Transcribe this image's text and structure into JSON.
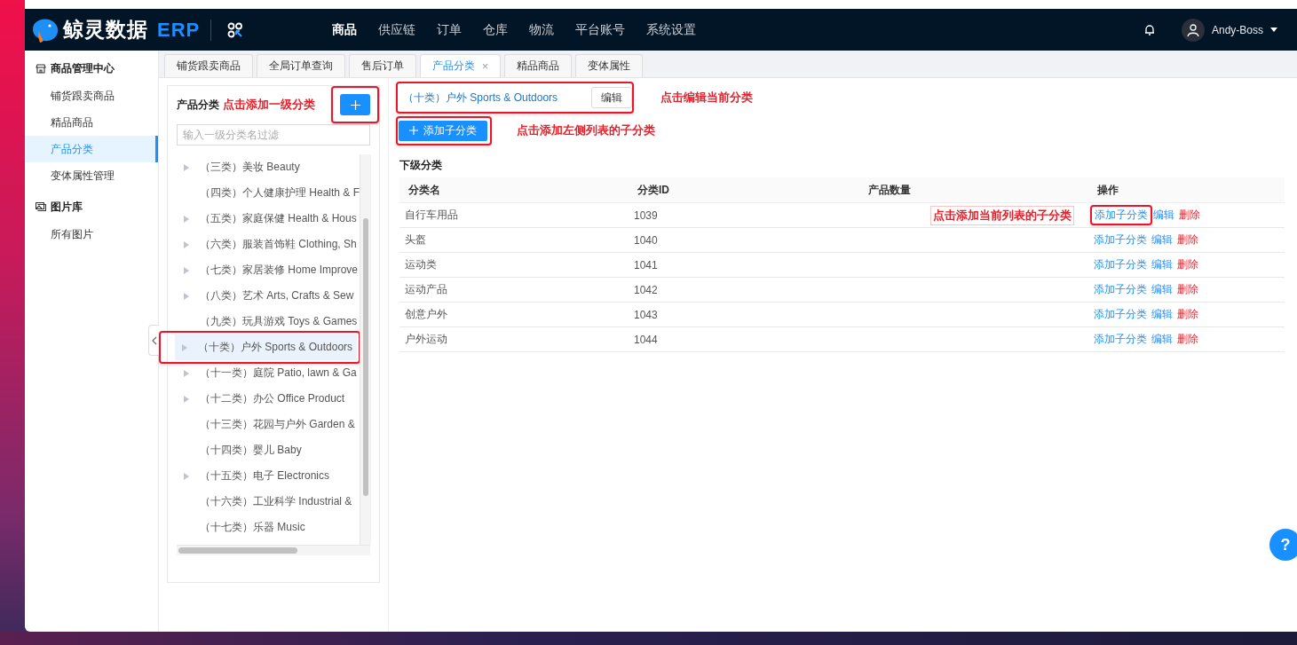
{
  "header": {
    "logo_text": "鲸灵数据",
    "logo_suffix": "ERP",
    "nav": [
      {
        "label": "商品",
        "selected": true
      },
      {
        "label": "供应链",
        "selected": false
      },
      {
        "label": "订单",
        "selected": false
      },
      {
        "label": "仓库",
        "selected": false
      },
      {
        "label": "物流",
        "selected": false
      },
      {
        "label": "平台账号",
        "selected": false
      },
      {
        "label": "系统设置",
        "selected": false
      }
    ],
    "user": "Andy-Boss"
  },
  "sidebar": {
    "groups": [
      {
        "title": "商品管理中心",
        "items": [
          {
            "label": "铺货跟卖商品",
            "selected": false
          },
          {
            "label": "精品商品",
            "selected": false
          },
          {
            "label": "产品分类",
            "selected": true
          },
          {
            "label": "变体属性管理",
            "selected": false
          }
        ]
      },
      {
        "title": "图片库",
        "items": [
          {
            "label": "所有图片",
            "selected": false
          }
        ]
      }
    ]
  },
  "tabs": [
    {
      "label": "铺货跟卖商品",
      "selected": false
    },
    {
      "label": "全局订单查询",
      "selected": false
    },
    {
      "label": "售后订单",
      "selected": false
    },
    {
      "label": "产品分类",
      "selected": true,
      "close": "×"
    },
    {
      "label": "精品商品",
      "selected": false
    },
    {
      "label": "变体属性",
      "selected": false
    }
  ],
  "category_panel": {
    "title": "产品分类",
    "annotation": "点击添加一级分类",
    "add_button": {
      "highlighted": true
    },
    "filter": {
      "placeholder": "输入一级分类名过滤"
    },
    "tree": [
      {
        "label": "（三类）美妆 Beauty",
        "expandable": true,
        "selected": false,
        "highlighted": false
      },
      {
        "label": "（四类）个人健康护理 Health & F",
        "expandable": false,
        "selected": false,
        "highlighted": false
      },
      {
        "label": "（五类）家庭保健 Health & Hous",
        "expandable": true,
        "selected": false,
        "highlighted": false
      },
      {
        "label": "（六类）服装首饰鞋 Clothing, Sh",
        "expandable": true,
        "selected": false,
        "highlighted": false
      },
      {
        "label": "（七类）家居装修 Home Improve",
        "expandable": true,
        "selected": false,
        "highlighted": false
      },
      {
        "label": "（八类）艺术 Arts, Crafts & Sew",
        "expandable": true,
        "selected": false,
        "highlighted": false
      },
      {
        "label": "（九类）玩具游戏 Toys & Games",
        "expandable": false,
        "selected": false,
        "highlighted": false
      },
      {
        "label": "（十类）户外 Sports & Outdoors",
        "expandable": true,
        "selected": true,
        "highlighted": true
      },
      {
        "label": "（十一类）庭院 Patio, lawn & Ga",
        "expandable": true,
        "selected": false,
        "highlighted": false
      },
      {
        "label": "（十二类）办公 Office Product",
        "expandable": true,
        "selected": false,
        "highlighted": false
      },
      {
        "label": "（十三类）花园与户外 Garden &",
        "expandable": false,
        "selected": false,
        "highlighted": false
      },
      {
        "label": "（十四类）婴儿 Baby",
        "expandable": false,
        "selected": false,
        "highlighted": false
      },
      {
        "label": "（十五类）电子 Electronics",
        "expandable": true,
        "selected": false,
        "highlighted": false
      },
      {
        "label": "（十六类）工业科学 Industrial &",
        "expandable": false,
        "selected": false,
        "highlighted": false
      },
      {
        "label": "（十七类）乐器 Music",
        "expandable": false,
        "selected": false,
        "highlighted": false
      }
    ]
  },
  "detail": {
    "current": {
      "label": "（十类）户外 Sports & Outdoors",
      "edit_button": "编辑",
      "highlighted": true
    },
    "edit_annotation": "点击编辑当前分类",
    "add_child": {
      "label": "添加子分类",
      "highlighted": true
    },
    "add_annotation": "点击添加左侧列表的子分类",
    "section_title": "下级分类",
    "table": {
      "columns": [
        "分类名",
        "分类ID",
        "产品数量",
        "操作"
      ],
      "rows": [
        {
          "name": "自行车用品",
          "id": "1039",
          "annotation": "点击添加当前列表的子分类",
          "actions": [
            {
              "label": "添加子分类",
              "kind": "link",
              "highlighted": true
            },
            {
              "label": "编辑",
              "kind": "link",
              "highlighted": false
            },
            {
              "label": "删除",
              "kind": "danger",
              "highlighted": false
            }
          ]
        },
        {
          "name": "头盔",
          "id": "1040",
          "actions": [
            {
              "label": "添加子分类",
              "kind": "link",
              "highlighted": false
            },
            {
              "label": "编辑",
              "kind": "link",
              "highlighted": false
            },
            {
              "label": "删除",
              "kind": "danger",
              "highlighted": false
            }
          ]
        },
        {
          "name": "运动类",
          "id": "1041",
          "actions": [
            {
              "label": "添加子分类",
              "kind": "link",
              "highlighted": false
            },
            {
              "label": "编辑",
              "kind": "link",
              "highlighted": false
            },
            {
              "label": "删除",
              "kind": "danger",
              "highlighted": false
            }
          ]
        },
        {
          "name": "运动产品",
          "id": "1042",
          "actions": [
            {
              "label": "添加子分类",
              "kind": "link",
              "highlighted": false
            },
            {
              "label": "编辑",
              "kind": "link",
              "highlighted": false
            },
            {
              "label": "删除",
              "kind": "danger",
              "highlighted": false
            }
          ]
        },
        {
          "name": "创意户外",
          "id": "1043",
          "actions": [
            {
              "label": "添加子分类",
              "kind": "link",
              "highlighted": false
            },
            {
              "label": "编辑",
              "kind": "link",
              "highlighted": false
            },
            {
              "label": "删除",
              "kind": "danger",
              "highlighted": false
            }
          ]
        },
        {
          "name": "户外运动",
          "id": "1044",
          "actions": [
            {
              "label": "添加子分类",
              "kind": "link",
              "highlighted": false
            },
            {
              "label": "编辑",
              "kind": "link",
              "highlighted": false
            },
            {
              "label": "删除",
              "kind": "danger",
              "highlighted": false
            }
          ]
        }
      ]
    }
  },
  "help_button": "?"
}
